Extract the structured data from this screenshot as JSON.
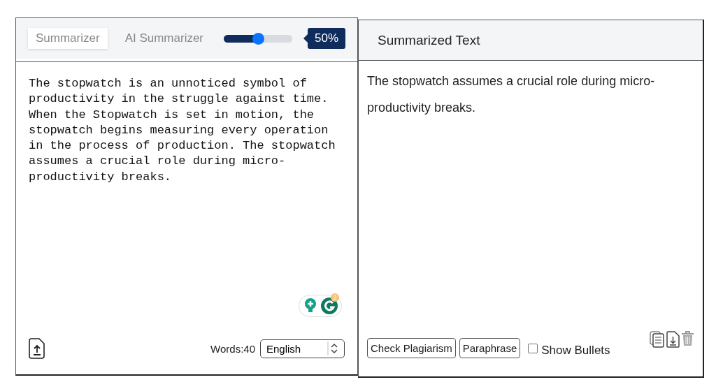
{
  "tabs": [
    {
      "label": "Summarizer",
      "selected": true
    },
    {
      "label": "AI Summarizer",
      "selected": false
    }
  ],
  "length_slider": {
    "level": 0.5,
    "reading": "50%"
  },
  "input": {
    "text": "The stopwatch is an unnoticed symbol of productivity in the struggle against time. When the Stopwatch is set in motion, the stopwatch begins measuring every operation in the process of production. The stopwatch assumes a crucial role during micro-productivity breaks.",
    "assistant_badge": "2",
    "word_count": "Words:40",
    "language": "English"
  },
  "output": {
    "title": "Summarized Text",
    "text": "The stopwatch assumes a crucial role during micro-productivity breaks.",
    "buttons": [
      "Check Plagiarism",
      "Paraphrase"
    ],
    "show_bullets": {
      "label": "Show Bullets",
      "checked": false
    }
  }
}
